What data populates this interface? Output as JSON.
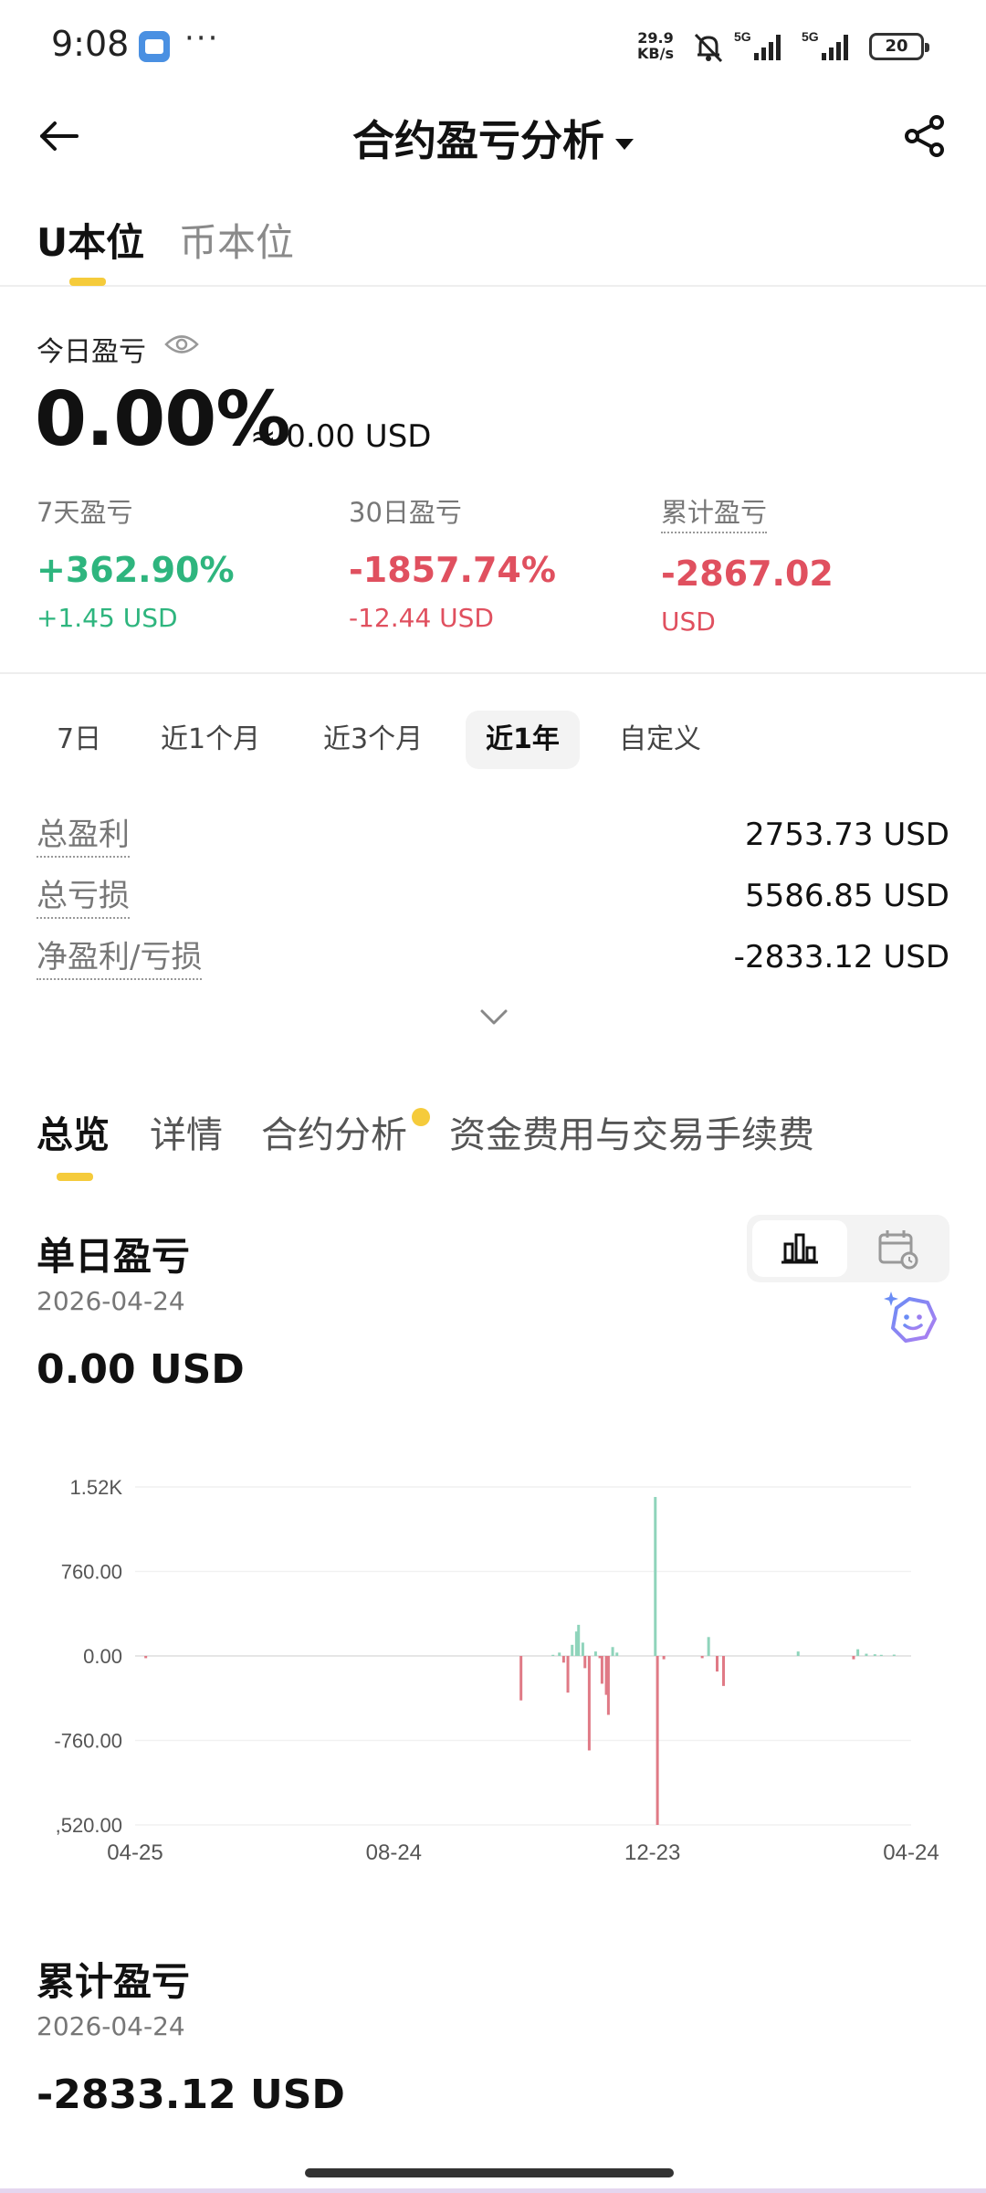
{
  "status_bar": {
    "time": "9:08",
    "overflow": "···",
    "speed_value": "29.9",
    "speed_unit": "KB/s",
    "network1": "5G",
    "network2": "5G",
    "battery": "20"
  },
  "header": {
    "title": "合约盈亏分析"
  },
  "top_tabs": [
    "U本位",
    "币本位"
  ],
  "today": {
    "label": "今日盈亏",
    "value": "0.00%",
    "usd": "≈ 0.00 USD"
  },
  "stats": [
    {
      "label": "7天盈亏",
      "pct": "+362.90%",
      "usd": "+1.45 USD",
      "tone": "green"
    },
    {
      "label": "30日盈亏",
      "pct": "-1857.74%",
      "usd": "-12.44 USD",
      "tone": "red"
    },
    {
      "label": "累计盈亏",
      "pct": "-2867.02",
      "usd": "USD",
      "tone": "red"
    }
  ],
  "period_tabs": [
    "7日",
    "近1个月",
    "近3个月",
    "近1年",
    "自定义"
  ],
  "period_selected": "近1年",
  "totals": [
    {
      "label": "总盈利",
      "value": "2753.73 USD"
    },
    {
      "label": "总亏损",
      "value": "5586.85 USD"
    },
    {
      "label": "净盈利/亏损",
      "value": "-2833.12 USD"
    }
  ],
  "section_tabs": [
    "总览",
    "详情",
    "合约分析",
    "资金费用与交易手续费"
  ],
  "daily": {
    "title": "单日盈亏",
    "date": "2026-04-24",
    "value": "0.00 USD"
  },
  "cumulative": {
    "title": "累计盈亏",
    "date": "2026-04-24",
    "value": "-2833.12 USD"
  },
  "colors": {
    "accent": "#f5cb3b",
    "positive": "#2eb57e",
    "negative": "#e0505f",
    "bar_positive": "#8fd4bb",
    "bar_negative": "#e07a86"
  },
  "chart_data": {
    "type": "bar",
    "y_tick_labels": [
      "1.52K",
      "760.00",
      "0.00",
      "-760.00",
      ",520.00"
    ],
    "x_tick_labels": [
      "04-25",
      "08-24",
      "12-23",
      "04-24"
    ],
    "ylim": [
      -1520,
      1520
    ],
    "x_domain_days": [
      0,
      364
    ],
    "series": [
      {
        "values": [
          {
            "day": 5,
            "value": -20
          },
          {
            "day": 181,
            "value": -400
          },
          {
            "day": 196,
            "value": 10
          },
          {
            "day": 199,
            "value": 30
          },
          {
            "day": 201,
            "value": -60
          },
          {
            "day": 203,
            "value": -330
          },
          {
            "day": 205,
            "value": 100
          },
          {
            "day": 207,
            "value": 220
          },
          {
            "day": 208,
            "value": 280
          },
          {
            "day": 210,
            "value": 120
          },
          {
            "day": 211,
            "value": -110
          },
          {
            "day": 213,
            "value": -850
          },
          {
            "day": 216,
            "value": 40
          },
          {
            "day": 218,
            "value": -20
          },
          {
            "day": 219,
            "value": -250
          },
          {
            "day": 221,
            "value": -350
          },
          {
            "day": 222,
            "value": -530
          },
          {
            "day": 224,
            "value": 80
          },
          {
            "day": 226,
            "value": 30
          },
          {
            "day": 244,
            "value": 1430
          },
          {
            "day": 245,
            "value": -1520
          },
          {
            "day": 248,
            "value": -30
          },
          {
            "day": 266,
            "value": -20
          },
          {
            "day": 269,
            "value": 170
          },
          {
            "day": 273,
            "value": -140
          },
          {
            "day": 276,
            "value": -270
          },
          {
            "day": 311,
            "value": 40
          },
          {
            "day": 337,
            "value": -30
          },
          {
            "day": 339,
            "value": 60
          },
          {
            "day": 343,
            "value": 20
          },
          {
            "day": 347,
            "value": 15
          },
          {
            "day": 350,
            "value": 10
          },
          {
            "day": 356,
            "value": 12
          }
        ]
      }
    ]
  }
}
